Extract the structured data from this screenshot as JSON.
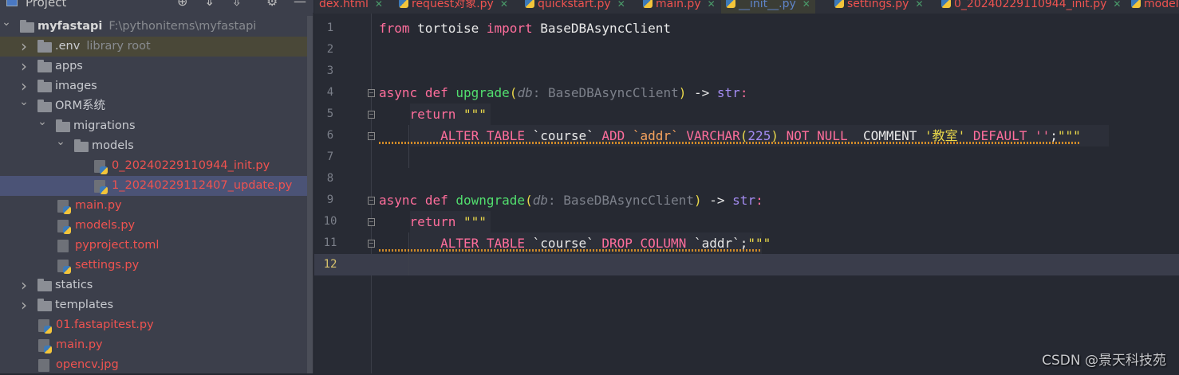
{
  "sidebar": {
    "title": "Project",
    "tree": [
      {
        "label": "myfastapi",
        "hint": "F:\\pythonitems\\myfastapi",
        "type": "folder",
        "level": 0,
        "open": true,
        "bold": true
      },
      {
        "label": ".env",
        "hint": "library root",
        "type": "folder",
        "level": 1,
        "open": false,
        "env": true
      },
      {
        "label": "apps",
        "type": "folder",
        "level": 1,
        "open": false
      },
      {
        "label": "images",
        "type": "folder",
        "level": 1,
        "open": false
      },
      {
        "label": "ORM系统",
        "type": "folder",
        "level": 1,
        "open": true
      },
      {
        "label": "migrations",
        "type": "folder",
        "level": 2,
        "open": true
      },
      {
        "label": "models",
        "type": "folder",
        "level": 3,
        "open": true
      },
      {
        "label": "0_20240229110944_init.py",
        "type": "py",
        "level": 4,
        "red": true
      },
      {
        "label": "1_20240229112407_update.py",
        "type": "py",
        "level": 4,
        "red": true,
        "selected": true
      },
      {
        "label": "main.py",
        "type": "py",
        "level": 2,
        "red": true
      },
      {
        "label": "models.py",
        "type": "py",
        "level": 2,
        "red": true
      },
      {
        "label": "pyproject.toml",
        "type": "toml",
        "level": 2,
        "red": true
      },
      {
        "label": "settings.py",
        "type": "py",
        "level": 2,
        "red": true
      },
      {
        "label": "statics",
        "type": "folder",
        "level": 1,
        "open": false
      },
      {
        "label": "templates",
        "type": "folder",
        "level": 1,
        "open": false
      },
      {
        "label": "01.fastapitest.py",
        "type": "py",
        "level": 1,
        "red": true
      },
      {
        "label": "main.py",
        "type": "py",
        "level": 1,
        "red": true
      },
      {
        "label": "opencv.jpg",
        "type": "img",
        "level": 1,
        "red": true
      }
    ]
  },
  "tabs": [
    {
      "label": "dex.html",
      "icon": false
    },
    {
      "label": "request对象.py",
      "icon": true
    },
    {
      "label": "quickstart.py",
      "icon": true
    },
    {
      "label": "main.py",
      "icon": true
    },
    {
      "label": "__init__.py",
      "icon": true,
      "active": true
    },
    {
      "label": "settings.py",
      "icon": true
    },
    {
      "label": "0_20240229110944_init.py",
      "icon": true
    },
    {
      "label": "models",
      "icon": true
    }
  ],
  "editor": {
    "current_line": 12,
    "lines": [
      [
        [
          "k",
          "from"
        ],
        [
          "w",
          " tortoise "
        ],
        [
          "k",
          "import"
        ],
        [
          "w",
          " BaseDBAsyncClient"
        ]
      ],
      [],
      [],
      [
        [
          "k",
          "async"
        ],
        [
          "w",
          " "
        ],
        [
          "k",
          "def"
        ],
        [
          "w",
          " "
        ],
        [
          "f",
          "upgrade"
        ],
        [
          "y",
          "("
        ],
        [
          "gi",
          "db"
        ],
        [
          "g",
          ": BaseDBAsyncClient"
        ],
        [
          "y",
          ")"
        ],
        [
          "w",
          " -> "
        ],
        [
          "p",
          "str"
        ],
        [
          "k",
          ":"
        ]
      ],
      [
        [
          "w",
          "    "
        ],
        [
          "k",
          "return"
        ],
        [
          "w",
          " "
        ],
        [
          "y",
          "\"\"\""
        ]
      ],
      [
        [
          "w",
          "        "
        ],
        [
          "k",
          "ALTER TABLE"
        ],
        [
          "w",
          " `course` "
        ],
        [
          "k",
          "ADD"
        ],
        [
          "w",
          " "
        ],
        [
          "o",
          "`addr`"
        ],
        [
          "w",
          " "
        ],
        [
          "k",
          "VARCHAR"
        ],
        [
          "y",
          "("
        ],
        [
          "n",
          "225"
        ],
        [
          "y",
          ")"
        ],
        [
          "w",
          " "
        ],
        [
          "k",
          "NOT NULL"
        ],
        [
          "w",
          "  COMMENT "
        ],
        [
          "y",
          "'教室'"
        ],
        [
          "w",
          " "
        ],
        [
          "k",
          "DEFAULT"
        ],
        [
          "w",
          " "
        ],
        [
          "k",
          "''"
        ],
        [
          "w",
          ";"
        ],
        [
          "y",
          "\"\"\""
        ]
      ],
      [],
      [],
      [
        [
          "k",
          "async"
        ],
        [
          "w",
          " "
        ],
        [
          "k",
          "def"
        ],
        [
          "w",
          " "
        ],
        [
          "f",
          "downgrade"
        ],
        [
          "y",
          "("
        ],
        [
          "gi",
          "db"
        ],
        [
          "g",
          ": BaseDBAsyncClient"
        ],
        [
          "y",
          ")"
        ],
        [
          "w",
          " -> "
        ],
        [
          "p",
          "str"
        ],
        [
          "k",
          ":"
        ]
      ],
      [
        [
          "w",
          "    "
        ],
        [
          "k",
          "return"
        ],
        [
          "w",
          " "
        ],
        [
          "y",
          "\"\"\""
        ]
      ],
      [
        [
          "w",
          "        "
        ],
        [
          "k",
          "ALTER TABLE"
        ],
        [
          "w",
          " `course` "
        ],
        [
          "k",
          "DROP COLUMN"
        ],
        [
          "w",
          " `addr`;"
        ],
        [
          "y",
          "\"\"\""
        ]
      ],
      []
    ]
  },
  "watermark": "CSDN @景天科技苑"
}
